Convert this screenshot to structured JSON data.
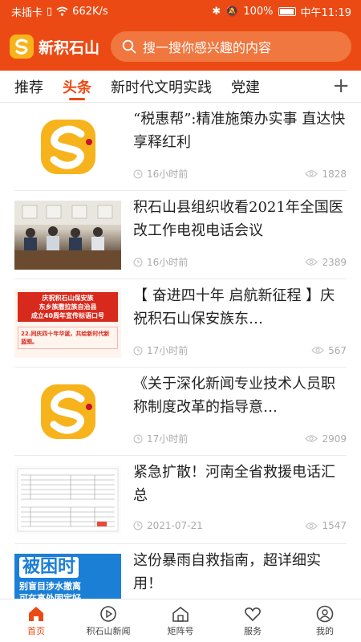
{
  "status_bar": {
    "sim": "未插卡",
    "speed": "662K/s",
    "battery": "100%",
    "time": "中午11:19"
  },
  "header": {
    "app_name": "新积石山",
    "search_placeholder": "搜一搜你感兴趣的内容"
  },
  "tabs": [
    {
      "label": "推荐",
      "active": false
    },
    {
      "label": "头条",
      "active": true
    },
    {
      "label": "新时代文明实践",
      "active": false
    },
    {
      "label": "党建",
      "active": false
    }
  ],
  "tab_add": "+",
  "feed": [
    {
      "title": "“税惠帮”:精准施策办实事 直达快享释红利",
      "time": "16小时前",
      "views": "1828",
      "thumb": "logo"
    },
    {
      "title": "积石山县组织收看2021年全国医改工作电视电话会议",
      "time": "16小时前",
      "views": "2389",
      "thumb": "meeting"
    },
    {
      "title": "【 奋进四十年   启航新征程 】庆祝积石山保安族东…",
      "time": "17小时前",
      "views": "567",
      "thumb": "banner",
      "thumb_text": [
        "庆祝积石山保安族",
        "东乡族撒拉族自治县",
        "成立40周年宣传标语口号",
        "22.同庆四十年华诞，共绘新时代新蓝图。"
      ]
    },
    {
      "title": "《关于深化新闻专业技术人员职称制度改革的指导意…",
      "time": "17小时前",
      "views": "2909",
      "thumb": "logo"
    },
    {
      "title": "紧急扩散！河南全省救援电话汇总",
      "time": "2021-07-21",
      "views": "1547",
      "thumb": "doc"
    },
    {
      "title": "这份暴雨自救指南，超详细实用！",
      "time": "",
      "views": "",
      "thumb": "blue",
      "thumb_text": [
        "被困时",
        "别盲目涉水撤离",
        "可在高处固定好"
      ]
    }
  ],
  "bottom_nav": [
    {
      "label": "首页",
      "icon": "home-icon",
      "active": true
    },
    {
      "label": "积石山新闻",
      "icon": "play-icon",
      "active": false
    },
    {
      "label": "矩阵号",
      "icon": "matrix-icon",
      "active": false
    },
    {
      "label": "服务",
      "icon": "heart-icon",
      "active": false
    },
    {
      "label": "我的",
      "icon": "user-icon",
      "active": false
    }
  ],
  "colors": {
    "brand": "#ec4a14",
    "logo_yellow": "#f7b31b",
    "muted": "#aaaaaa"
  }
}
